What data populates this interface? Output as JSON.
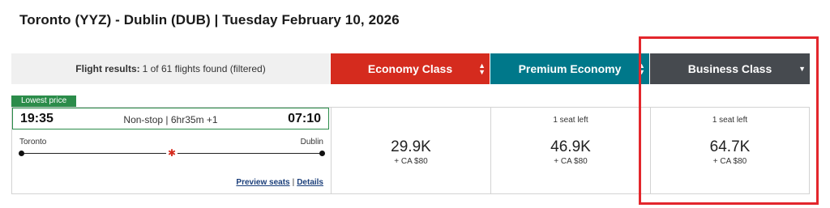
{
  "route": {
    "title": "Toronto (YYZ) - Dublin (DUB)  |  Tuesday February 10, 2026"
  },
  "results": {
    "label": "Flight results:",
    "summary": "1 of 61 flights found (filtered)"
  },
  "tabs": [
    {
      "label": "Economy Class",
      "color": "#d52b1e",
      "arrow": "sort-updown-icon"
    },
    {
      "label": "Premium Economy",
      "color": "#00788a",
      "arrow": "sort-updown-icon"
    },
    {
      "label": "Business Class",
      "color": "#464a4f",
      "arrow": "caret-down-icon"
    }
  ],
  "flight": {
    "badge": "Lowest price",
    "departure_time": "19:35",
    "arrival_time": "07:10",
    "stops": "Non-stop | 6hr35m +1",
    "origin": "Toronto",
    "destination": "Dublin",
    "preview_seats": "Preview seats",
    "details": "Details",
    "separator": "|"
  },
  "fares": [
    {
      "seats": "",
      "points": "29.9K",
      "tax": "+ CA $80"
    },
    {
      "seats": "1 seat left",
      "points": "46.9K",
      "tax": "+ CA $80"
    },
    {
      "seats": "1 seat left",
      "points": "64.7K",
      "tax": "+ CA $80"
    }
  ],
  "colors": {
    "accent_green": "#2b8c4a",
    "highlight_red": "#e3262c",
    "link_blue": "#1a3e7a"
  }
}
